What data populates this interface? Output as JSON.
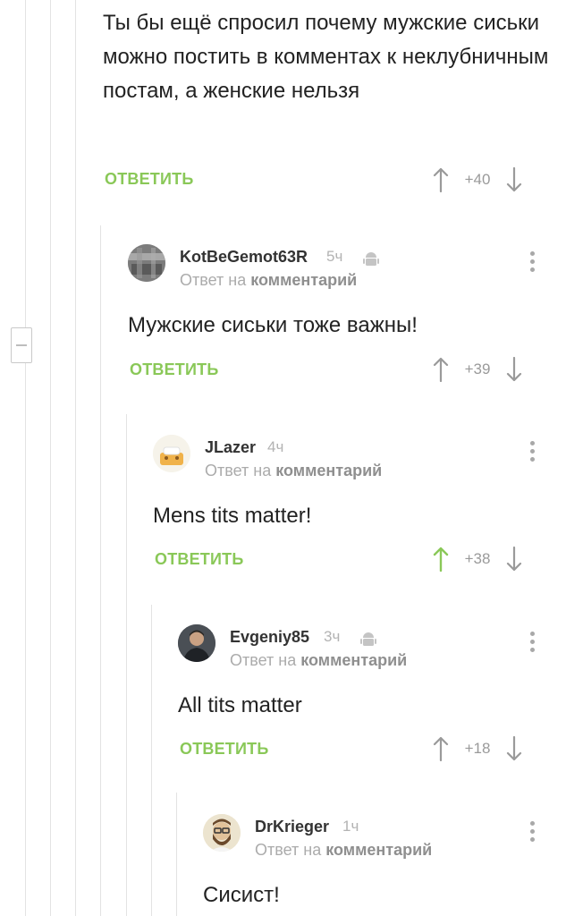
{
  "comments": [
    {
      "text": "Ты бы ещё спросил почему мужские сиськи можно постить в комментах к неклубничным постам, а женские нельзя",
      "reply_label": "ОТВЕТИТЬ",
      "score": "+40",
      "upvoted": false
    },
    {
      "username": "KotBeGemot63R",
      "time": "5ч",
      "platform_icon": "android-icon",
      "reply_to_prefix": "Ответ на",
      "reply_to_link": "комментарий",
      "text": "Мужские сиськи тоже важны!",
      "reply_label": "ОТВЕТИТЬ",
      "score": "+39",
      "upvoted": false
    },
    {
      "username": "JLazer",
      "time": "4ч",
      "reply_to_prefix": "Ответ на",
      "reply_to_link": "комментарий",
      "text": "Mens tits matter!",
      "reply_label": "ОТВЕТИТЬ",
      "score": "+38",
      "upvoted": true
    },
    {
      "username": "Evgeniy85",
      "time": "3ч",
      "platform_icon": "android-icon",
      "reply_to_prefix": "Ответ на",
      "reply_to_link": "комментарий",
      "text": "All tits matter",
      "reply_label": "ОТВЕТИТЬ",
      "score": "+18",
      "upvoted": false
    },
    {
      "username": "DrKrieger",
      "time": "1ч",
      "reply_to_prefix": "Ответ на",
      "reply_to_link": "комментарий",
      "text": "Сисист!"
    }
  ],
  "colors": {
    "accent_green": "#8ac858",
    "text": "#222222",
    "muted": "#ababab",
    "thread_line": "#e3e3e3"
  }
}
